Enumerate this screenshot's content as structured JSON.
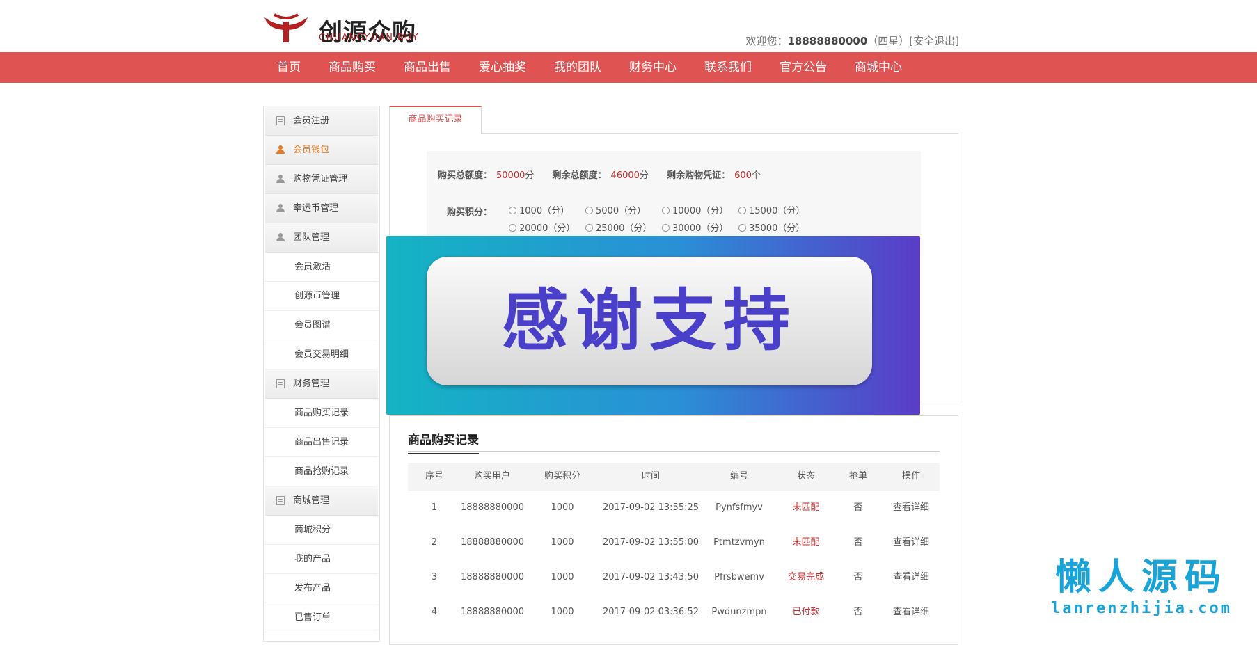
{
  "header": {
    "logo_cn": "创源众购",
    "logo_en": "CHUANGYUAN BUY",
    "welcome_prefix": "欢迎您：",
    "username": "18888880000",
    "level": "（四星）",
    "logout": "[安全退出]"
  },
  "nav": [
    "首页",
    "商品购买",
    "商品出售",
    "爱心抽奖",
    "我的团队",
    "财务中心",
    "联系我们",
    "官方公告",
    "商城中心"
  ],
  "sidebar": {
    "items": [
      {
        "label": "会员注册"
      },
      {
        "label": "会员钱包"
      },
      {
        "label": "购物凭证管理"
      },
      {
        "label": "幸运币管理"
      },
      {
        "label": "团队管理"
      },
      {
        "label": "会员激活"
      },
      {
        "label": "创源币管理"
      },
      {
        "label": "会员图谱"
      },
      {
        "label": "会员交易明细"
      },
      {
        "label": "财务管理"
      },
      {
        "label": "商品购买记录"
      },
      {
        "label": "商品出售记录"
      },
      {
        "label": "商品抢购记录"
      },
      {
        "label": "商城管理"
      },
      {
        "label": "商城积分"
      },
      {
        "label": "我的产品"
      },
      {
        "label": "发布产品"
      },
      {
        "label": "已售订单"
      }
    ]
  },
  "purchase": {
    "tab": "商品购买记录",
    "total_label": "购买总额度：",
    "total_value": "50000",
    "remain_label": "剩余总额度：",
    "remain_value": "46000",
    "voucher_label": "剩余购物凭证：",
    "voucher_value": "600",
    "unit_points": "分",
    "unit_count": "个",
    "buy_label": "购买积分：",
    "options": [
      "1000（分）",
      "5000（分）",
      "10000（分）",
      "15000（分）",
      "20000（分）",
      "25000（分）",
      "30000（分）",
      "35000（分）"
    ]
  },
  "banner": {
    "text": "感谢支持"
  },
  "records": {
    "title": "商品购买记录",
    "columns": [
      "序号",
      "购买用户",
      "购买积分",
      "时间",
      "编号",
      "状态",
      "抢单",
      "操作"
    ],
    "rows": [
      {
        "no": "1",
        "user": "18888880000",
        "points": "1000",
        "time": "2017-09-02 13:55:25",
        "code": "Pynfsfmyv",
        "status": "未匹配",
        "grab": "否",
        "action": "查看详细"
      },
      {
        "no": "2",
        "user": "18888880000",
        "points": "1000",
        "time": "2017-09-02 13:55:00",
        "code": "Ptmtzvmyn",
        "status": "未匹配",
        "grab": "否",
        "action": "查看详细"
      },
      {
        "no": "3",
        "user": "18888880000",
        "points": "1000",
        "time": "2017-09-02 13:43:50",
        "code": "Pfrsbwemv",
        "status": "交易完成",
        "grab": "否",
        "action": "查看详细"
      },
      {
        "no": "4",
        "user": "18888880000",
        "points": "1000",
        "time": "2017-09-02 03:36:52",
        "code": "Pwdunzmpn",
        "status": "已付款",
        "grab": "否",
        "action": "查看详细"
      }
    ]
  },
  "watermark": {
    "cn": "懒人源码",
    "en": "lanrenzhijia.com"
  },
  "colors": {
    "nav_bg": "#e05353",
    "status_red": "#c42b2b",
    "accent_orange": "#e57b22",
    "watermark_blue": "#18a4d8"
  }
}
